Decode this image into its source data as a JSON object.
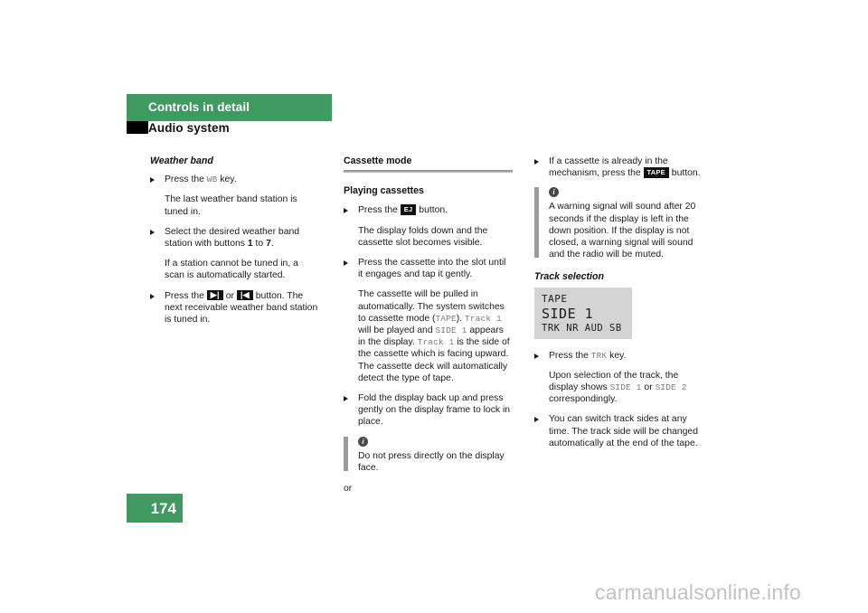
{
  "document": {
    "header_title": "Controls in detail",
    "subheader_title": "Audio system",
    "page_number": "174",
    "watermark": "carmanualsonline.info"
  },
  "column1": {
    "section_title": "Weather band",
    "b1_pre": "Press the ",
    "b1_key": "WB",
    "b1_post": " key.",
    "p1": "The last weather band station is tuned in.",
    "b2_pre": "Select the desired weather band station with buttons ",
    "b2_num1": "1",
    "b2_mid": " to ",
    "b2_num2": "7",
    "b2_post": ".",
    "p2": "If a station cannot be tuned in, a scan is automatically started.",
    "b3_pre": "Press the ",
    "b3_key1": "▶|",
    "b3_mid": " or ",
    "b3_key2": "|◀",
    "b3_post": " button. The next receivable weather band station is tuned in."
  },
  "column2": {
    "section_title": "Cassette mode",
    "sub_title": "Playing cassettes",
    "b1_pre": "Press the ",
    "b1_key": "EJ",
    "b1_post": " button.",
    "p1": "The display folds down and the cassette slot becomes visible.",
    "b2": "Press the cassette into the slot until it engages and tap it gently.",
    "p2_a": "The cassette will be pulled in automatically. The system switches to cassette mode (",
    "p2_mono1": "TAPE",
    "p2_b": "). ",
    "p2_mono2": "Track 1",
    "p2_c": " will be played and ",
    "p2_mono3": "SIDE 1",
    "p2_d": " appears in the display. ",
    "p2_mono4": "Track 1",
    "p2_e": " is the side of the cassette which is facing upward. The cassette deck will automatically detect the type of tape.",
    "b3": "Fold the display back up and press gently on the display frame to lock in place.",
    "note_icon": "info-icon",
    "note_text": "Do not press directly on the display face.",
    "or_text": "or"
  },
  "column3": {
    "b1_pre": "If a cassette is already in the mechanism, press the ",
    "b1_key": "TAPE",
    "b1_post": " button.",
    "note_icon": "info-icon",
    "note_text": "A warning signal will sound after 20 seconds if the display is left in the down position. If the display is not closed, a warning signal will sound and the radio will be muted.",
    "section_title": "Track selection",
    "lcd": {
      "line1": "TAPE",
      "line2": "SIDE 1",
      "line3": "TRK NR AUD SB"
    },
    "b2_pre": "Press the ",
    "b2_key": "TRK",
    "b2_post": " key.",
    "p1_a": "Upon selection of the track, the display shows ",
    "p1_mono1": "SIDE 1",
    "p1_b": " or ",
    "p1_mono2": "SIDE 2",
    "p1_c": " correspondingly.",
    "b3": "You can switch track sides at any time. The track side will be changed automatically at the end of the tape."
  },
  "colors": {
    "brand_green": "#3e9a5f",
    "text": "#1c1c1c",
    "mono_gray": "#7b7b7b",
    "lcd_bg": "#d4d4d4",
    "note_bar": "#9a9a9a",
    "watermark": "#c2c2c2"
  }
}
